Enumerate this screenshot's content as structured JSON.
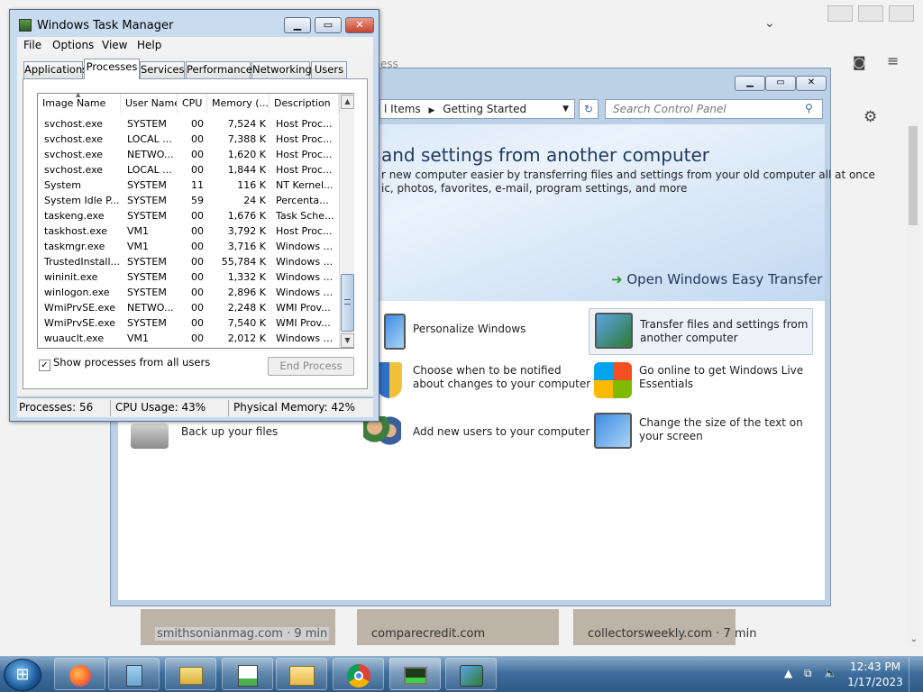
{
  "task_manager": {
    "title": "Windows Task Manager",
    "menu": [
      "File",
      "Options",
      "View",
      "Help"
    ],
    "tabs": [
      "Applications",
      "Processes",
      "Services",
      "Performance",
      "Networking",
      "Users"
    ],
    "active_tab": "Processes",
    "columns": [
      "Image Name",
      "User Name",
      "CPU",
      "Memory (...",
      "Description"
    ],
    "rows": [
      [
        "svchost.exe",
        "SYSTEM",
        "00",
        "7,524 K",
        "Host Proc..."
      ],
      [
        "svchost.exe",
        "LOCAL ...",
        "00",
        "7,388 K",
        "Host Proc..."
      ],
      [
        "svchost.exe",
        "NETWO...",
        "00",
        "1,620 K",
        "Host Proc..."
      ],
      [
        "svchost.exe",
        "LOCAL ...",
        "00",
        "1,844 K",
        "Host Proc..."
      ],
      [
        "System",
        "SYSTEM",
        "11",
        "116 K",
        "NT Kernel..."
      ],
      [
        "System Idle P...",
        "SYSTEM",
        "59",
        "24 K",
        "Percenta..."
      ],
      [
        "taskeng.exe",
        "SYSTEM",
        "00",
        "1,676 K",
        "Task Sche..."
      ],
      [
        "taskhost.exe",
        "VM1",
        "00",
        "3,792 K",
        "Host Proc..."
      ],
      [
        "taskmgr.exe",
        "VM1",
        "00",
        "3,716 K",
        "Windows ..."
      ],
      [
        "TrustedInstall...",
        "SYSTEM",
        "00",
        "55,784 K",
        "Windows ..."
      ],
      [
        "wininit.exe",
        "SYSTEM",
        "00",
        "1,332 K",
        "Windows ..."
      ],
      [
        "winlogon.exe",
        "SYSTEM",
        "00",
        "2,896 K",
        "Windows ..."
      ],
      [
        "WmiPrvSE.exe",
        "NETWO...",
        "00",
        "2,248 K",
        "WMI Prov..."
      ],
      [
        "WmiPrvSE.exe",
        "SYSTEM",
        "00",
        "7,540 K",
        "WMI Prov..."
      ],
      [
        "wuauclt.exe",
        "VM1",
        "00",
        "2,012 K",
        "Windows ..."
      ]
    ],
    "show_all_label": "Show processes from all users",
    "show_all_checked": "✓",
    "end_process_label": "End Process",
    "status": {
      "processes": "Processes: 56",
      "cpu": "CPU Usage: 43%",
      "memory": "Physical Memory: 42%"
    }
  },
  "control_panel": {
    "breadcrumb_partial": "l Items",
    "breadcrumb_current": "Getting Started",
    "search_placeholder": "Search Control Panel",
    "hero_title": "and settings from another computer",
    "hero_line1": "r new computer easier by transferring files and settings from your old computer all at once",
    "hero_line2": "ic, photos, favorites, e-mail, program settings, and more",
    "easy_transfer": "Open Windows Easy Transfer",
    "tasks": [
      "Personalize Windows",
      "Transfer files and settings from another computer",
      "Choose when to be notified about changes to your computer",
      "Go online to get Windows Live Essentials",
      "Back up your files",
      "Add new users to your computer",
      "Change the size of the text on your screen"
    ]
  },
  "browser": {
    "behind_text": "ess",
    "cards": [
      "smithsonianmag.com · 9 min",
      "comparecredit.com",
      "collectorsweekly.com · 7 min"
    ]
  },
  "taskbar": {
    "time": "12:43 PM",
    "date": "1/17/2023",
    "apps": [
      "firefox-icon",
      "notepad-icon",
      "folder-icon",
      "paint-icon",
      "explorer-icon",
      "chrome-icon",
      "taskmgr-icon",
      "control-panel-icon"
    ]
  }
}
